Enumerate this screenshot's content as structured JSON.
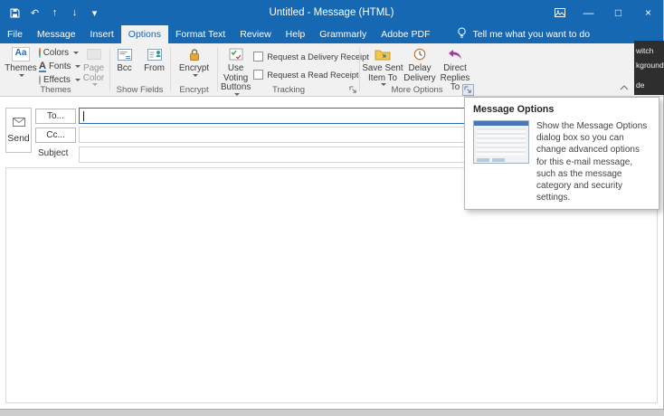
{
  "colors": {
    "titlebar_blue": "#1568b1",
    "ribbon_bg": "#f1f1f1",
    "focus_blue": "#2b6cb5",
    "lock_gold": "#e3a83c",
    "reply_purple": "#9b3f97"
  },
  "titlebar": {
    "title": "Untitled  -  Message (HTML)",
    "qat": {
      "undo": "↶",
      "previous": "↑",
      "next": "↓",
      "customize": "▾"
    },
    "window_controls": {
      "minimize": "—",
      "maximize": "□",
      "close": "×"
    }
  },
  "tabs": {
    "file": "File",
    "message": "Message",
    "insert": "Insert",
    "options": "Options",
    "format_text": "Format Text",
    "review": "Review",
    "help": "Help",
    "grammarly": "Grammarly",
    "adobe_pdf": "Adobe PDF",
    "tell_me": "Tell me what you want to do"
  },
  "ribbon": {
    "themes_group": {
      "label": "Themes",
      "themes": "Themes",
      "themes_icon_text": "Aa",
      "colors": "Colors",
      "fonts": "Fonts",
      "fonts_icon_text": "A",
      "effects": "Effects",
      "page_color": "Page Color"
    },
    "show_fields_group": {
      "label": "Show Fields",
      "bcc": "Bcc",
      "from": "From"
    },
    "encrypt_group": {
      "label": "Encrypt",
      "encrypt": "Encrypt"
    },
    "tracking_group": {
      "label": "Tracking",
      "voting": "Use Voting Buttons",
      "delivery_receipt": "Request a Delivery Receipt",
      "read_receipt": "Request a Read Receipt"
    },
    "more_options_group": {
      "label": "More Options",
      "save_sent": "Save Sent Item To",
      "delay": "Delay Delivery",
      "direct_replies": "Direct Replies To"
    }
  },
  "compose": {
    "send": "Send",
    "to": "To...",
    "cc": "Cc...",
    "subject": "Subject"
  },
  "tooltip": {
    "title": "Message Options",
    "body": "Show the Message Options dialog box so you can change advanced options for this e-mail message, such as the message category and security settings."
  },
  "fragment": {
    "line1": "witch",
    "line2": "kground",
    "line3": "de"
  }
}
